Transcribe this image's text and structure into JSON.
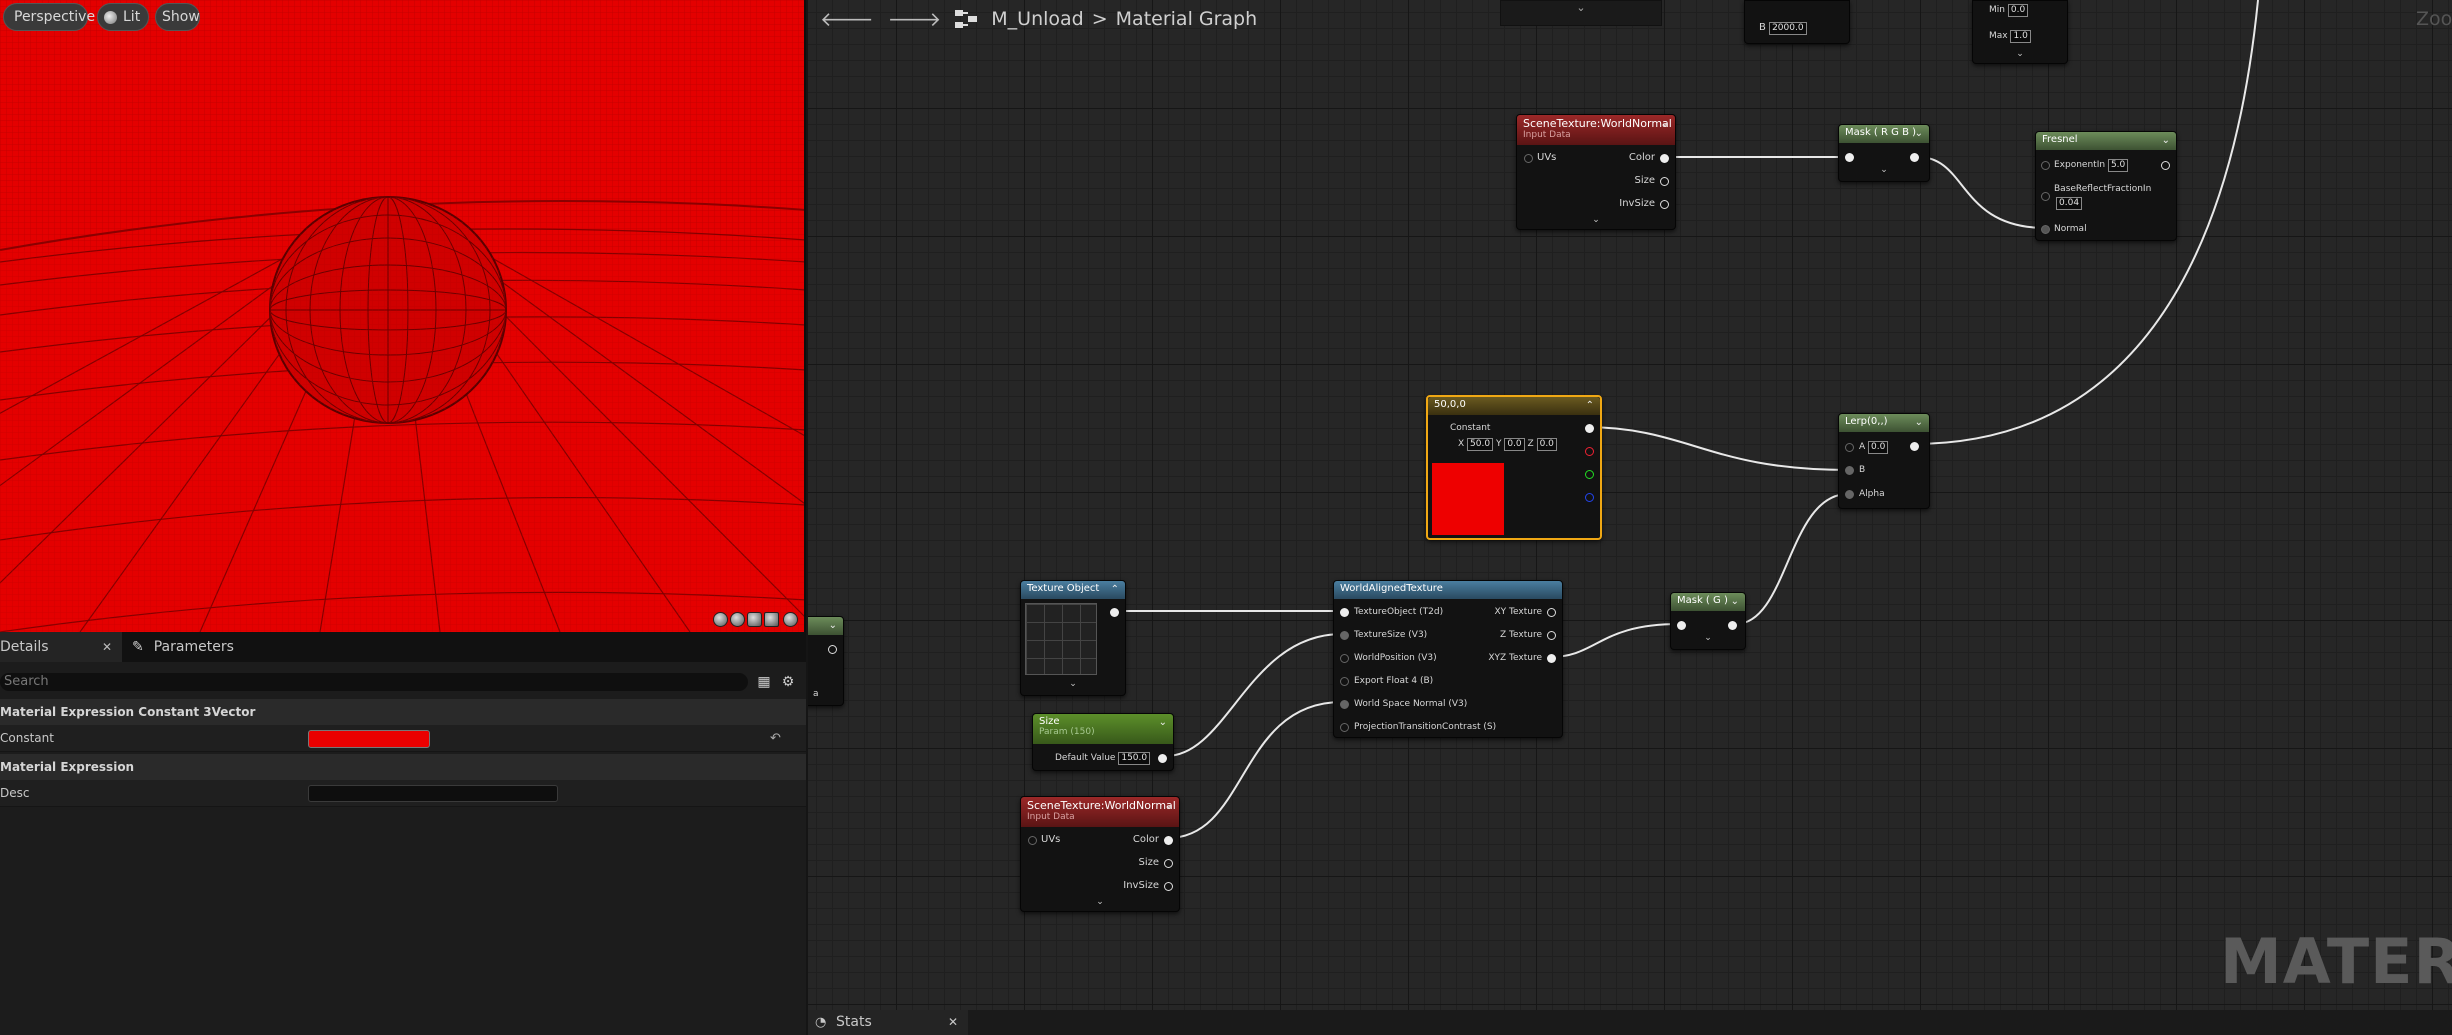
{
  "viewport": {
    "perspective_label": "Perspective",
    "lit_label": "Lit",
    "show_label": "Show"
  },
  "details": {
    "tabs": [
      {
        "label": "Details"
      },
      {
        "label": "Parameters"
      }
    ],
    "search_placeholder": "Search",
    "category1": "Material Expression Constant 3Vector",
    "prop_constant_label": "Constant",
    "constant_color": "#ea0000",
    "category2": "Material Expression",
    "prop_desc_label": "Desc"
  },
  "graph": {
    "breadcrumb_asset": "M_Unload",
    "breadcrumb_sep": ">",
    "breadcrumb_graph": "Material Graph",
    "watermark": "MATERIA",
    "zoom_label": "Zoo",
    "top_partial": {
      "b_label": "B",
      "b_value": "2000.0",
      "min_label": "Min",
      "min_value": "0.0",
      "max_label": "Max",
      "max_value": "1.0"
    },
    "nodes": {
      "scenetex_top": {
        "title": "SceneTexture:WorldNormal",
        "subtitle": "Input Data",
        "in_uvs": "UVs",
        "out_color": "Color",
        "out_size": "Size",
        "out_invsize": "InvSize"
      },
      "mask_rgb": {
        "title": "Mask ( R G B )"
      },
      "fresnel": {
        "title": "Fresnel",
        "exponent_label": "ExponentIn",
        "exponent_value": "5.0",
        "brf_label": "BaseReflectFractionIn",
        "brf_value": "0.04",
        "normal_label": "Normal"
      },
      "constant3": {
        "title": "50,0,0",
        "constant_label": "Constant",
        "x_label": "X",
        "x_value": "50.0",
        "y_label": "Y",
        "y_value": "0.0",
        "z_label": "Z",
        "z_value": "0.0",
        "preview_color": "#ee0000"
      },
      "lerp": {
        "title": "Lerp(0,,)",
        "a_label": "A",
        "a_value": "0.0",
        "b_label": "B",
        "alpha_label": "Alpha"
      },
      "texobj": {
        "title": "Texture Object"
      },
      "size": {
        "title": "Size",
        "subtitle": "Param (150)",
        "default_label": "Default Value",
        "default_value": "150.0"
      },
      "worldaligned": {
        "title": "WorldAlignedTexture",
        "in1": "TextureObject (T2d)",
        "in2": "TextureSize (V3)",
        "in3": "WorldPosition (V3)",
        "in4": "Export Float 4 (B)",
        "in5": "World Space Normal (V3)",
        "in6": "ProjectionTransitionContrast (S)",
        "out1": "XY Texture",
        "out2": "Z Texture",
        "out3": "XYZ Texture"
      },
      "mask_g": {
        "title": "Mask ( G )"
      },
      "scenetex_bottom": {
        "title": "SceneTexture:WorldNormal",
        "subtitle": "Input Data",
        "in_uvs": "UVs",
        "out_color": "Color",
        "out_size": "Size",
        "out_invsize": "InvSize"
      },
      "partial_left": {
        "label": "a"
      }
    }
  },
  "stats": {
    "tab_label": "Stats"
  }
}
